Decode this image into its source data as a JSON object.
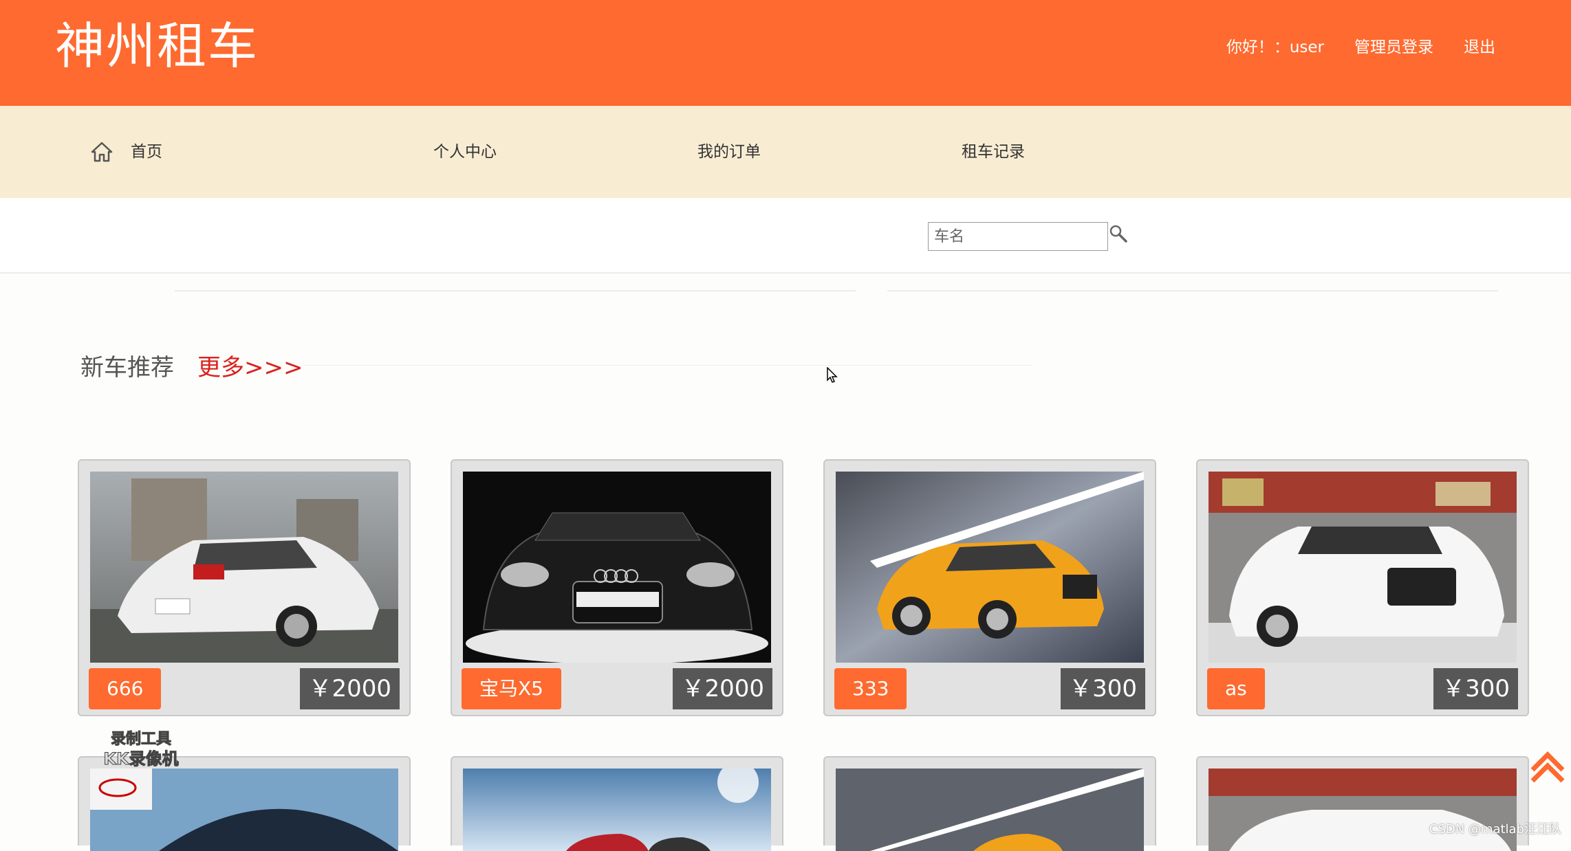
{
  "header": {
    "brand": "神州租车",
    "greeting": "你好！：user",
    "admin_login": "管理员登录",
    "logout": "退出"
  },
  "nav": {
    "items": [
      {
        "label": "首页",
        "icon": "home-icon"
      },
      {
        "label": "个人中心"
      },
      {
        "label": "我的订单"
      },
      {
        "label": "租车记录"
      }
    ]
  },
  "search": {
    "placeholder": "车名",
    "icon": "search-icon"
  },
  "section": {
    "title": "新车推荐",
    "more": "更多>>>"
  },
  "cars": [
    {
      "name": "666",
      "price": "￥2000"
    },
    {
      "name": "宝马X5",
      "price": "￥2000"
    },
    {
      "name": "333",
      "price": "￥300"
    },
    {
      "name": "as",
      "price": "￥300"
    }
  ],
  "watermark": {
    "recorder": "录制工具 KK录像机",
    "credit": "CSDN @matlab汪汪队"
  },
  "colors": {
    "accent": "#fe6a2f",
    "nav_bg": "#f8edd3",
    "price_bg": "#575757",
    "more_link": "#d9221d"
  }
}
